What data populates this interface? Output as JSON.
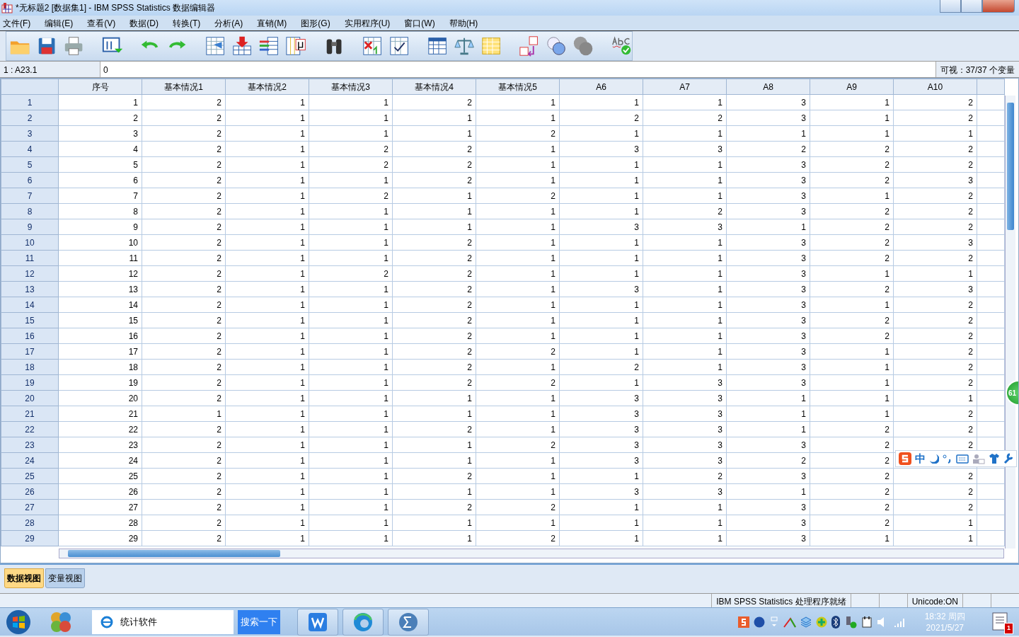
{
  "window": {
    "title": "*无标题2 [数据集1] - IBM SPSS Statistics 数据编辑器"
  },
  "menu": [
    "文件(F)",
    "编辑(E)",
    "查看(V)",
    "数据(D)",
    "转换(T)",
    "分析(A)",
    "直销(M)",
    "图形(G)",
    "实用程序(U)",
    "窗口(W)",
    "帮助(H)"
  ],
  "cell_editor": {
    "cell": "1 : A23.1",
    "value": "0"
  },
  "visible_vars": "可视：37/37 个变量",
  "table": {
    "columns": [
      "序号",
      "基本情况1",
      "基本情况2",
      "基本情况3",
      "基本情况4",
      "基本情况5",
      "A6",
      "A7",
      "A8",
      "A9",
      "A10"
    ],
    "rows": [
      {
        "label": "1",
        "cells": [
          "1",
          "2",
          "1",
          "1",
          "2",
          "1",
          "1",
          "1",
          "3",
          "1",
          "2"
        ]
      },
      {
        "label": "2",
        "cells": [
          "2",
          "2",
          "1",
          "1",
          "1",
          "1",
          "2",
          "2",
          "3",
          "1",
          "2"
        ]
      },
      {
        "label": "3",
        "cells": [
          "3",
          "2",
          "1",
          "1",
          "1",
          "2",
          "1",
          "1",
          "1",
          "1",
          "1"
        ]
      },
      {
        "label": "4",
        "cells": [
          "4",
          "2",
          "1",
          "2",
          "2",
          "1",
          "3",
          "3",
          "2",
          "2",
          "2"
        ]
      },
      {
        "label": "5",
        "cells": [
          "5",
          "2",
          "1",
          "2",
          "2",
          "1",
          "1",
          "1",
          "3",
          "2",
          "2"
        ]
      },
      {
        "label": "6",
        "cells": [
          "6",
          "2",
          "1",
          "1",
          "2",
          "1",
          "1",
          "1",
          "3",
          "2",
          "3"
        ]
      },
      {
        "label": "7",
        "cells": [
          "7",
          "2",
          "1",
          "2",
          "1",
          "2",
          "1",
          "1",
          "3",
          "1",
          "2"
        ]
      },
      {
        "label": "8",
        "cells": [
          "8",
          "2",
          "1",
          "1",
          "1",
          "1",
          "1",
          "2",
          "3",
          "2",
          "2"
        ]
      },
      {
        "label": "9",
        "cells": [
          "9",
          "2",
          "1",
          "1",
          "1",
          "1",
          "3",
          "3",
          "1",
          "2",
          "2"
        ]
      },
      {
        "label": "10",
        "cells": [
          "10",
          "2",
          "1",
          "1",
          "2",
          "1",
          "1",
          "1",
          "3",
          "2",
          "3"
        ]
      },
      {
        "label": "11",
        "cells": [
          "11",
          "2",
          "1",
          "1",
          "2",
          "1",
          "1",
          "1",
          "3",
          "2",
          "2"
        ]
      },
      {
        "label": "12",
        "cells": [
          "12",
          "2",
          "1",
          "2",
          "2",
          "1",
          "1",
          "1",
          "3",
          "1",
          "1"
        ]
      },
      {
        "label": "13",
        "cells": [
          "13",
          "2",
          "1",
          "1",
          "2",
          "1",
          "3",
          "1",
          "3",
          "2",
          "3"
        ]
      },
      {
        "label": "14",
        "cells": [
          "14",
          "2",
          "1",
          "1",
          "2",
          "1",
          "1",
          "1",
          "3",
          "1",
          "2"
        ]
      },
      {
        "label": "15",
        "cells": [
          "15",
          "2",
          "1",
          "1",
          "2",
          "1",
          "1",
          "1",
          "3",
          "2",
          "2"
        ]
      },
      {
        "label": "16",
        "cells": [
          "16",
          "2",
          "1",
          "1",
          "2",
          "1",
          "1",
          "1",
          "3",
          "2",
          "2"
        ]
      },
      {
        "label": "17",
        "cells": [
          "17",
          "2",
          "1",
          "1",
          "2",
          "2",
          "1",
          "1",
          "3",
          "1",
          "2"
        ]
      },
      {
        "label": "18",
        "cells": [
          "18",
          "2",
          "1",
          "1",
          "2",
          "1",
          "2",
          "1",
          "3",
          "1",
          "2"
        ]
      },
      {
        "label": "19",
        "cells": [
          "19",
          "2",
          "1",
          "1",
          "2",
          "2",
          "1",
          "3",
          "3",
          "1",
          "2"
        ]
      },
      {
        "label": "20",
        "cells": [
          "20",
          "2",
          "1",
          "1",
          "1",
          "1",
          "3",
          "3",
          "1",
          "1",
          "1"
        ]
      },
      {
        "label": "21",
        "cells": [
          "21",
          "1",
          "1",
          "1",
          "1",
          "1",
          "3",
          "3",
          "1",
          "1",
          "2"
        ]
      },
      {
        "label": "22",
        "cells": [
          "22",
          "2",
          "1",
          "1",
          "2",
          "1",
          "3",
          "3",
          "1",
          "2",
          "2"
        ]
      },
      {
        "label": "23",
        "cells": [
          "23",
          "2",
          "1",
          "1",
          "1",
          "2",
          "3",
          "3",
          "3",
          "2",
          "2"
        ]
      },
      {
        "label": "24",
        "cells": [
          "24",
          "2",
          "1",
          "1",
          "1",
          "1",
          "3",
          "3",
          "2",
          "2",
          null
        ]
      },
      {
        "label": "25",
        "cells": [
          "25",
          "2",
          "1",
          "1",
          "2",
          "1",
          "1",
          "2",
          "3",
          "2",
          "2"
        ]
      },
      {
        "label": "26",
        "cells": [
          "26",
          "2",
          "1",
          "1",
          "1",
          "1",
          "3",
          "3",
          "1",
          "2",
          "2"
        ]
      },
      {
        "label": "27",
        "cells": [
          "27",
          "2",
          "1",
          "1",
          "2",
          "2",
          "1",
          "1",
          "3",
          "2",
          "2"
        ]
      },
      {
        "label": "28",
        "cells": [
          "28",
          "2",
          "1",
          "1",
          "1",
          "1",
          "1",
          "1",
          "3",
          "2",
          "1"
        ]
      },
      {
        "label": "29",
        "cells": [
          "29",
          "2",
          "1",
          "1",
          "1",
          "2",
          "1",
          "1",
          "3",
          "1",
          "1"
        ]
      }
    ]
  },
  "view_tabs": [
    {
      "label": "数据视图",
      "selected": true
    },
    {
      "label": "变量视图",
      "selected": false
    }
  ],
  "status_bar": [
    "IBM SPSS Statistics 处理程序就绪",
    "Unicode:ON"
  ],
  "floating_badge": "61",
  "ime_toolbar": {
    "mode": "中"
  },
  "taskbar": {
    "search": {
      "value": "统计软件"
    },
    "search_button": "搜索一下",
    "clock": {
      "time": "18:32 周四",
      "date": "2021/5/27"
    },
    "notification_count": "1"
  }
}
